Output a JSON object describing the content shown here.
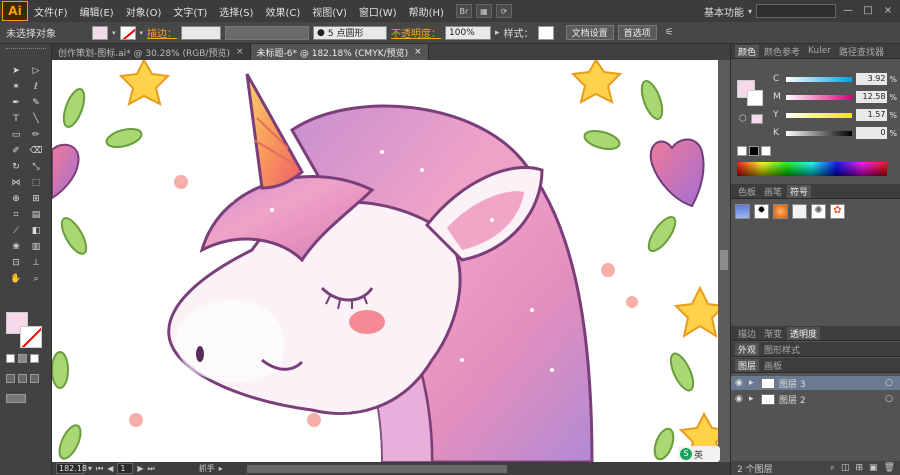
{
  "app": {
    "logo": "Ai"
  },
  "menu": [
    "文件(F)",
    "编辑(E)",
    "对象(O)",
    "文字(T)",
    "选择(S)",
    "效果(C)",
    "视图(V)",
    "窗口(W)",
    "帮助(H)"
  ],
  "menu_icons": [
    "bridge-icon",
    "arrange-icon",
    "sync-icon"
  ],
  "workspace": {
    "label": "基本功能",
    "window_controls": [
      "—",
      "□",
      "×"
    ]
  },
  "control_bar": {
    "selection": "未选择对象",
    "stroke_label": "描边：",
    "brush": "5 点圆形",
    "opacity_label": "不透明度：",
    "opacity_value": "100%",
    "style_label": "样式：",
    "doc_settings": "文档设置",
    "preferences": "首选项"
  },
  "tabs": [
    {
      "label": "创作策划-图标.ai* @ 30.28% (RGB/预览)",
      "active": false
    },
    {
      "label": "未标题-6* @ 182.18% (CMYK/预览)",
      "active": true
    }
  ],
  "color_panel": {
    "tabs": [
      "颜色",
      "颜色参考",
      "Kuler",
      "路径查找器"
    ],
    "channels": [
      {
        "label": "C",
        "value": "3.92",
        "unit": "%",
        "color": "#00a0e0"
      },
      {
        "label": "M",
        "value": "12.58",
        "unit": "%",
        "color": "#e0007a"
      },
      {
        "label": "Y",
        "value": "1.57",
        "unit": "%",
        "color": "#f2e600"
      },
      {
        "label": "K",
        "value": "0",
        "unit": "%",
        "color": "#000000"
      }
    ],
    "fill_color": "#f5d8ea"
  },
  "swatches_panel": {
    "tabs": [
      "色板",
      "画笔",
      "符号"
    ]
  },
  "transparency_panel": {
    "tabs": [
      "描边",
      "渐变",
      "透明度"
    ]
  },
  "appearance_panel": {
    "tabs": [
      "外观",
      "图形样式"
    ]
  },
  "layers_panel": {
    "tabs": [
      "图层",
      "画板"
    ],
    "layers": [
      {
        "name": "图层 3",
        "selected": true
      },
      {
        "name": "图层 2",
        "selected": false
      }
    ],
    "count": "2 个图层"
  },
  "status_bar": {
    "zoom": "182.18",
    "page": "1",
    "tool": "抓手"
  },
  "ime": {
    "label": "英"
  }
}
